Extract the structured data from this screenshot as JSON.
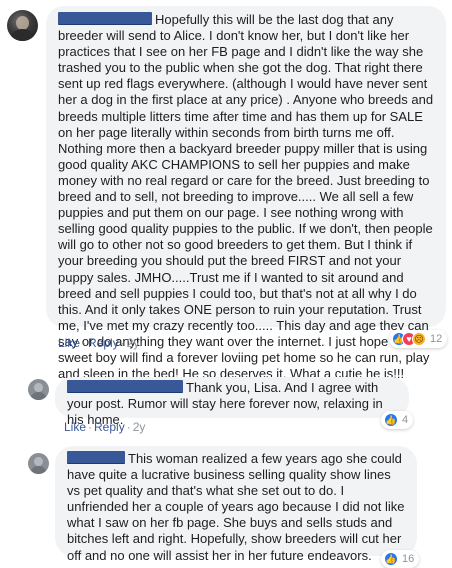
{
  "colors": {
    "bubble_bg": "#f2f3f5",
    "link": "#385898",
    "like": "#2078f4",
    "love": "#f33e58",
    "sad": "#f7b125"
  },
  "comments": [
    {
      "text": "Hopefully this will be the last dog that any breeder will send to Alice. I don't know her, but I don't like her practices that I see on her FB page and I didn't like the way she trashed you to the public when she got the dog. That right there sent up red flags everywhere. (although I would have never sent her a dog in the first place at any price) . Anyone who breeds and breeds multiple litters time after time and has them up for SALE on her page literally within seconds from birth turns me off. Nothing more then a backyard breeder puppy miller that is using good quality AKC CHAMPIONS to sell her puppies and make money with no real regard or care for the breed. Just breeding to breed and to sell, not breeding to improve..... We all sell a few puppies and put them on our page. I see nothing wrong with selling good quality puppies to the public. If we don't, then people will go to other not so good breeders to get them. But I think if your breeding you should put the breed FIRST and not your puppy sales. JMHO.....Trust me if I wanted to sit around and breed and sell puppies I could too, but that's not at all why I do this. And it only takes ONE person to ruin your reputation. Trust me, I've met my crazy recently too..... This day and age they can say or do anything they want over the internet. I just hope that sweet boy will find a forever loviing pet home so he can run, play and sleep in the bed! He so deserves it. What a cutie he is!!!",
      "like": "Like",
      "reply": "Reply",
      "age": "2y",
      "reaction_icons": [
        "like-icon",
        "love-icon",
        "sad-icon"
      ],
      "reaction_count": "12"
    },
    {
      "text": "Thank you, Lisa. And I agree with your post. Rumor will stay here forever now, relaxing in his home.",
      "like": "Like",
      "reply": "Reply",
      "age": "2y",
      "reaction_icons": [
        "like-icon"
      ],
      "reaction_count": "4"
    },
    {
      "text": "This woman realized a few years ago she could have quite a lucrative business selling quality show lines vs pet quality and that's what she set out to do. I unfriended her a couple of years ago because I did not like what I saw on her fb page. She buys and sells studs and bitches left and right. Hopefully, show breeders will cut her off and no one will assist her in her future endeavors.",
      "reaction_count": "16"
    }
  ]
}
